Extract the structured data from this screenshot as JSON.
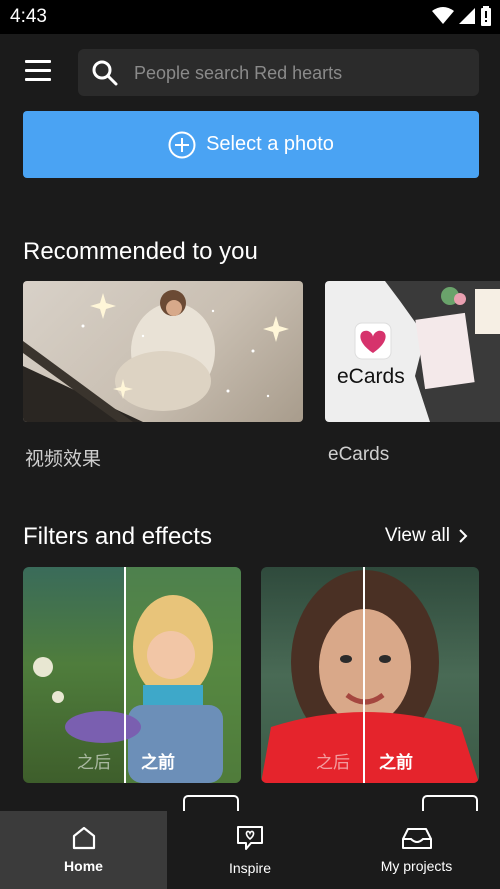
{
  "status": {
    "time": "4:43"
  },
  "search": {
    "placeholder": "People search Red hearts"
  },
  "select_photo": {
    "label": "Select a photo"
  },
  "recommended": {
    "title": "Recommended to you",
    "items": [
      {
        "label": "视频效果"
      },
      {
        "label": "eCards",
        "badge_text": "eCards"
      }
    ]
  },
  "filters": {
    "title": "Filters and effects",
    "view_all": "View all",
    "cards": [
      {
        "after": "之后",
        "before": "之前"
      },
      {
        "after": "之后",
        "before": "之前"
      }
    ]
  },
  "nav": {
    "items": [
      {
        "label": "Home",
        "icon": "home-icon"
      },
      {
        "label": "Inspire",
        "icon": "heart-chat-icon"
      },
      {
        "label": "My projects",
        "icon": "inbox-icon"
      }
    ]
  },
  "colors": {
    "accent": "#4aa3f3",
    "background": "#1b1b1b"
  }
}
